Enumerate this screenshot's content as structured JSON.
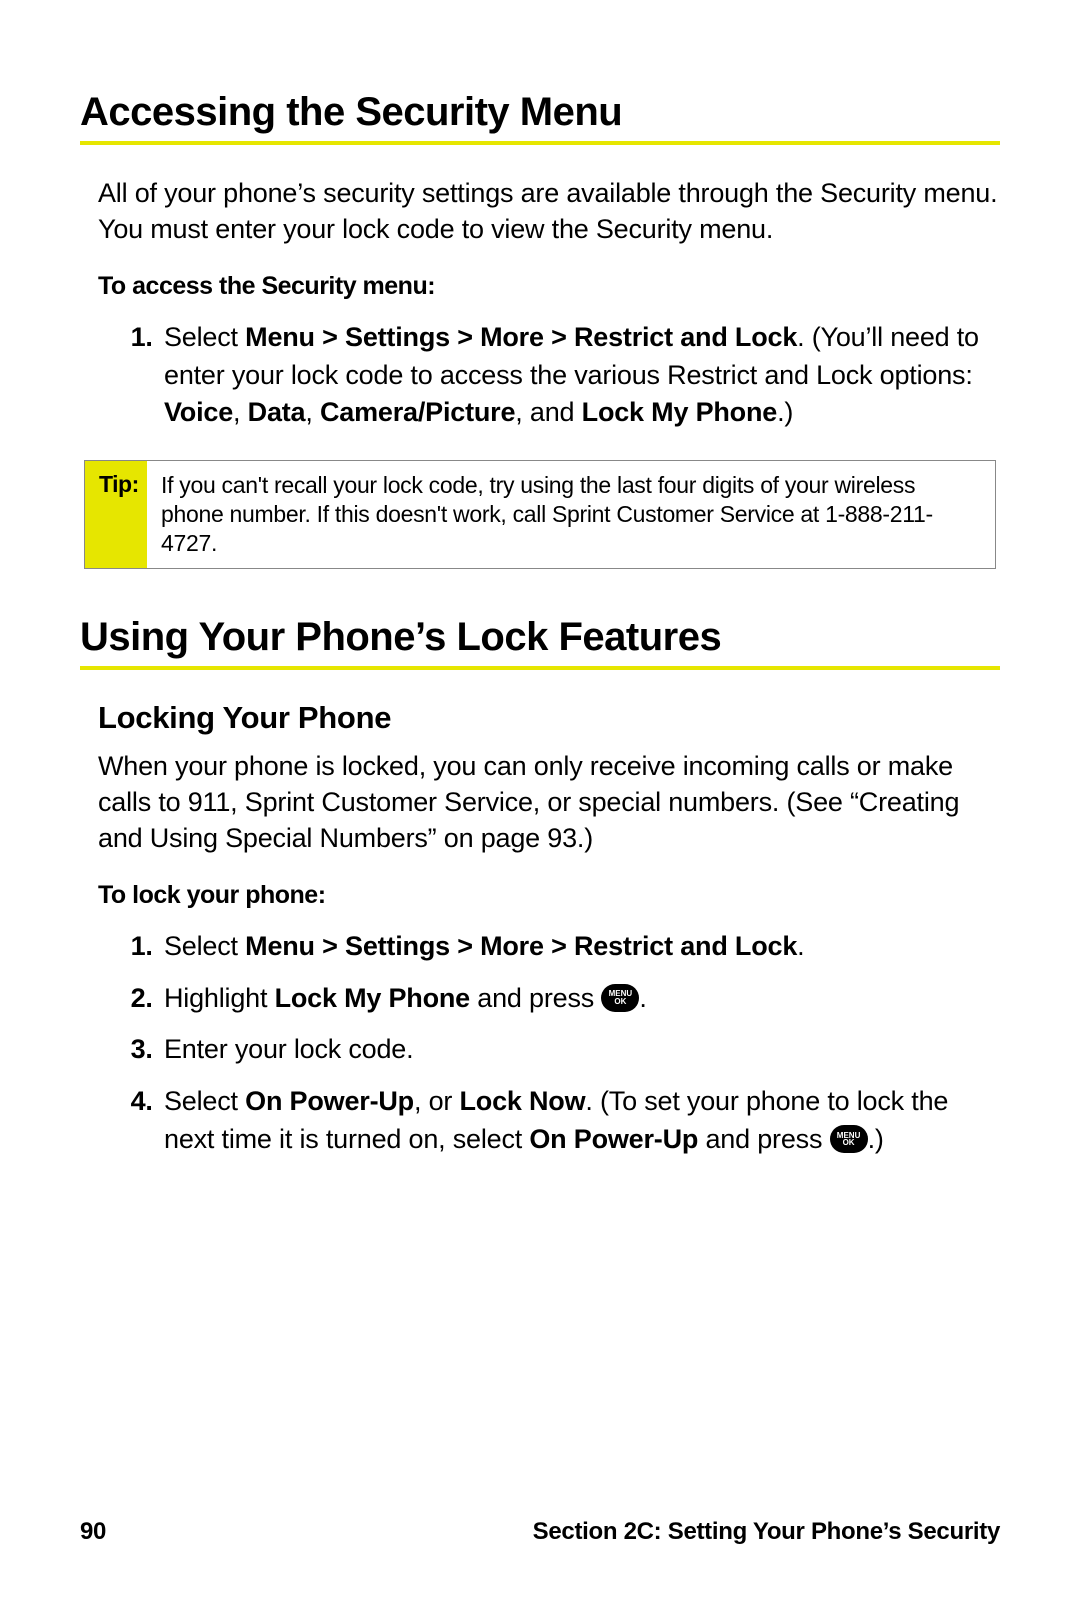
{
  "section1": {
    "title": "Accessing the Security Menu",
    "intro": "All of your phone’s security settings are available through the Security menu. You must enter your lock code to view the Security menu.",
    "subhead": "To access the Security menu:",
    "step1": {
      "pre": "Select ",
      "bold1": "Menu > Settings > More > Restrict and Lock",
      "mid1": ". (You’ll need to enter your lock code to access the various Restrict and Lock options: ",
      "b_voice": "Voice",
      "s_c1": ", ",
      "b_data": "Data",
      "s_c2": ", ",
      "b_cam": "Camera/Picture",
      "s_c3": ", and ",
      "b_lock": "Lock My Phone",
      "end": ".)"
    },
    "tip": {
      "label": "Tip:",
      "text": "If you can't recall your lock code, try using the last four digits of your wireless phone number. If this doesn't work, call Sprint Customer Service at 1-888-211-4727."
    }
  },
  "section2": {
    "title": "Using Your Phone’s Lock Features",
    "sub1": {
      "title": "Locking Your Phone",
      "intro": "When your phone is locked, you can only receive incoming calls or make calls to 911, Sprint Customer Service, or special numbers. (See “Creating and Using Special Numbers” on page 93.)",
      "subhead": "To lock your phone:",
      "step1": {
        "pre": "Select ",
        "bold": "Menu > Settings > More > Restrict and Lock",
        "end": "."
      },
      "step2": {
        "pre": "Highlight ",
        "bold": "Lock My Phone",
        "mid": " and press ",
        "end": "."
      },
      "step3": "Enter your lock code.",
      "step4": {
        "pre": "Select ",
        "b1": "On Power-Up",
        "s1": ", or ",
        "b2": "Lock Now",
        "s2": ". (To set your phone to lock the next time it is turned on, select ",
        "b3": "On Power-Up",
        "s3": " and press ",
        "end": ".)"
      }
    }
  },
  "menuok": {
    "top": "MENU",
    "bottom": "OK"
  },
  "footer": {
    "page": "90",
    "section": "Section 2C: Setting Your Phone’s Security"
  }
}
